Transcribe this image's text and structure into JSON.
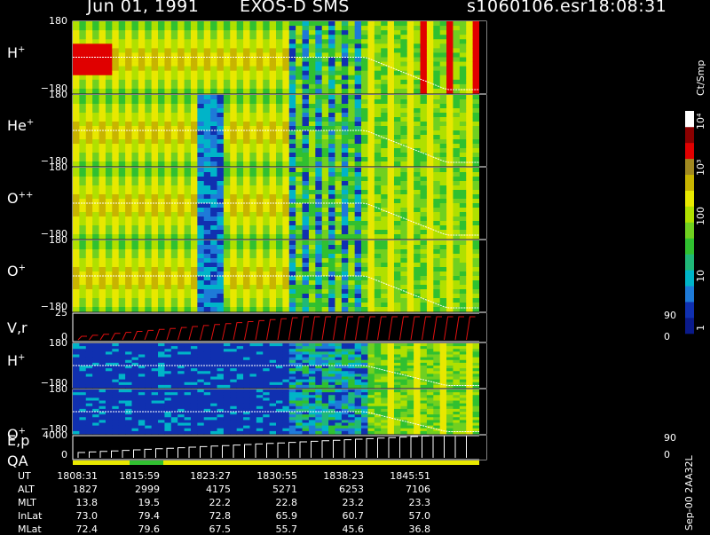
{
  "header": {
    "date": "Jun 01, 1991",
    "mission": "EXOS-D SMS",
    "file": "s1060106.esr",
    "time": "18:08:31"
  },
  "panels": [
    {
      "id": "h",
      "label": "H",
      "sup": "+",
      "ytop": "180",
      "ybot": "−180"
    },
    {
      "id": "he",
      "label": "He",
      "sup": "+",
      "ytop": "180",
      "ybot": "−180"
    },
    {
      "id": "o2",
      "label": "O",
      "sup": "++",
      "ytop": "180",
      "ybot": "−180"
    },
    {
      "id": "o",
      "label": "O",
      "sup": "+",
      "ytop": "180",
      "ybot": "−180"
    },
    {
      "id": "vr",
      "label": "V,r",
      "sup": "",
      "ytop": "25",
      "ybot": "0",
      "rtop": "90",
      "rbot": "0"
    },
    {
      "id": "h2",
      "label": "H",
      "sup": "+",
      "ytop": "180",
      "ybot": "−180"
    },
    {
      "id": "o3",
      "label": "O",
      "sup": "+",
      "ytop": "180",
      "ybot": "−180"
    },
    {
      "id": "ep",
      "label": "E,p",
      "sup": "",
      "ytop": "4000",
      "ybot": "0",
      "rtop": "90",
      "rbot": "0"
    },
    {
      "id": "qa",
      "label": "QA",
      "sup": ""
    }
  ],
  "colorbar": {
    "title": "Ct/Smp",
    "ticks": [
      "1",
      "10",
      "100",
      "10³",
      "10⁴"
    ],
    "colors": [
      "#0a1a8a",
      "#1030b0",
      "#1e7ad8",
      "#00b4c8",
      "#20b878",
      "#30c030",
      "#70d020",
      "#b0e000",
      "#e8e800",
      "#c8b400",
      "#a08820",
      "#e00000",
      "#8a0000",
      "#ffffff"
    ]
  },
  "table": {
    "rows": [
      {
        "label": "UT",
        "values": [
          "1808:31",
          "1815:59",
          "1823:27",
          "1830:55",
          "1838:23",
          "1845:51"
        ]
      },
      {
        "label": "ALT",
        "values": [
          "1827",
          "2999",
          "4175",
          "5271",
          "6253",
          "7106"
        ]
      },
      {
        "label": "MLT",
        "values": [
          "13.8",
          "19.5",
          "22.2",
          "22.8",
          "23.2",
          "23.3"
        ]
      },
      {
        "label": "InLat",
        "values": [
          "73.0",
          "79.4",
          "72.8",
          "65.9",
          "60.7",
          "57.0"
        ]
      },
      {
        "label": "MLat",
        "values": [
          "72.4",
          "79.6",
          "67.5",
          "55.7",
          "45.6",
          "36.8"
        ]
      }
    ]
  },
  "footer_id": "Sep-00 2AA32L",
  "chart_data": {
    "type": "heatmap",
    "title": "Jun 01, 1991 EXOS-D SMS",
    "x_ticks": [
      "1808:31",
      "1815:59",
      "1823:27",
      "1830:55",
      "1838:23",
      "1845:51"
    ],
    "panels": [
      "H+",
      "He+",
      "O++",
      "O+",
      "V,r",
      "H+",
      "O+",
      "E,p",
      "QA"
    ],
    "pitch_angle_range": [
      -180,
      180
    ],
    "vr_range": [
      0,
      25
    ],
    "ep_range": [
      0,
      4000
    ],
    "colorbar_scale": "log",
    "colorbar_range": [
      1,
      10000
    ],
    "colorbar_label": "Ct/Smp"
  }
}
